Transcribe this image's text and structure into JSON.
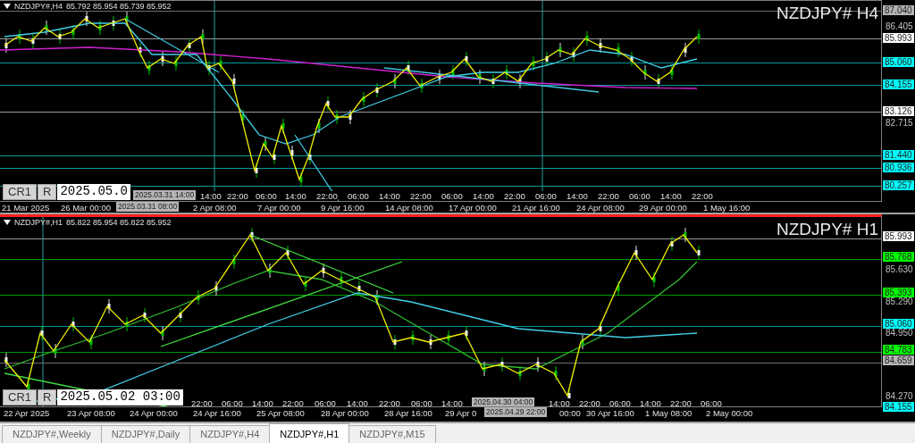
{
  "charts": [
    {
      "header_symbol": "NZDJPY#,H4",
      "header_ohlc": "85.792 85.954 85.739 85.952",
      "symbol_label": "NZDJPY# H4",
      "active": false,
      "price_labels": [
        {
          "text": "87.040",
          "kind": "tag",
          "color": "#b4b4b4"
        },
        {
          "text": "86.405",
          "kind": "tick"
        },
        {
          "text": "85.993",
          "kind": "tag",
          "color": "#ffffff"
        },
        {
          "text": "85.060",
          "kind": "tag",
          "color": "#00ffff"
        },
        {
          "text": "84.155",
          "kind": "tag",
          "color": "#00ffff"
        },
        {
          "text": "83.126",
          "kind": "tag",
          "color": "#ffffff"
        },
        {
          "text": "82.715",
          "kind": "tick"
        },
        {
          "text": "81.440",
          "kind": "tag",
          "color": "#00ffff"
        },
        {
          "text": "80.936",
          "kind": "tag",
          "color": "#00ffff"
        },
        {
          "text": "80.257",
          "kind": "tag",
          "color": "#00ffff"
        }
      ],
      "time_row_1": [
        "14:00",
        "22:00",
        "06:00",
        "14:00",
        "22:00",
        "06:00",
        "14:00",
        "22:00",
        "06:00",
        "14:00",
        "22:00",
        "06:00",
        "14:00",
        "22:00",
        "06:00",
        "14:00",
        "22:00"
      ],
      "time_row_2": [
        "21 Mar 2025",
        "26 Mar 00:00",
        "2 Apr 08:00",
        "7 Apr 00:00",
        "9 Apr 16:00",
        "14 Apr 08:00",
        "17 Apr 00:00",
        "21 Apr 16:00",
        "24 Apr 08:00",
        "29 Apr 00:00",
        "1 May 16:00"
      ],
      "time_tags": [
        "2025.03.31 14:00",
        "2025.03.31 08:00"
      ],
      "toolbox": {
        "cr_button": "CR1",
        "r_button": "R",
        "date_value": "2025.05.0"
      }
    },
    {
      "header_symbol": "NZDJPY#,H1",
      "header_ohlc": "85.822 85.954 85.822 85.952",
      "symbol_label": "NZDJPY# H1",
      "active": true,
      "price_labels": [
        {
          "text": "85.993",
          "kind": "tag",
          "color": "#ffffff"
        },
        {
          "text": "85.768",
          "kind": "tag",
          "color": "#00ff00"
        },
        {
          "text": "85.630",
          "kind": "tick"
        },
        {
          "text": "85.393",
          "kind": "tag",
          "color": "#00ff00"
        },
        {
          "text": "85.290",
          "kind": "tick"
        },
        {
          "text": "85.060",
          "kind": "tag",
          "color": "#00ffff"
        },
        {
          "text": "84.950",
          "kind": "tick"
        },
        {
          "text": "84.783",
          "kind": "tag",
          "color": "#00ff00"
        },
        {
          "text": "84.659",
          "kind": "tag",
          "color": "#b4b4b4"
        },
        {
          "text": "84.270",
          "kind": "tick"
        },
        {
          "text": "84.155",
          "kind": "tag",
          "color": "#00ffff"
        }
      ],
      "time_row_1": [
        "22:00",
        "06:00",
        "14:00",
        "22:00",
        "06:00",
        "14:00",
        "22:00",
        "06:00",
        "14:00",
        "14:00",
        "22:00",
        "06:00",
        "14:00",
        "22:00",
        "06:00"
      ],
      "time_row_2": [
        "22 Apr 2025",
        "23 Apr 08:00",
        "24 Apr 00:00",
        "24 Apr 16:00",
        "25 Apr 08:00",
        "28 Apr 00:00",
        "28 Apr 16:00",
        "29 Apr 0",
        "00:00",
        "30 Apr 16:00",
        "1 May 08:00",
        "2 May 00:00"
      ],
      "time_tags": [
        "2025.04.30 04:00",
        "2025.04.29 22:00"
      ],
      "toolbox": {
        "cr_button": "CR1",
        "r_button": "R",
        "date_value": "2025.05.02 03:00"
      }
    }
  ],
  "tabs": [
    {
      "label": "NZDJPY#,Weekly",
      "selected": false
    },
    {
      "label": "NZDJPY#,Daily",
      "selected": false
    },
    {
      "label": "NZDJPY#,H4",
      "selected": false
    },
    {
      "label": "NZDJPY#,H1",
      "selected": true
    },
    {
      "label": "NZDJPY#,M15",
      "selected": false
    }
  ]
}
